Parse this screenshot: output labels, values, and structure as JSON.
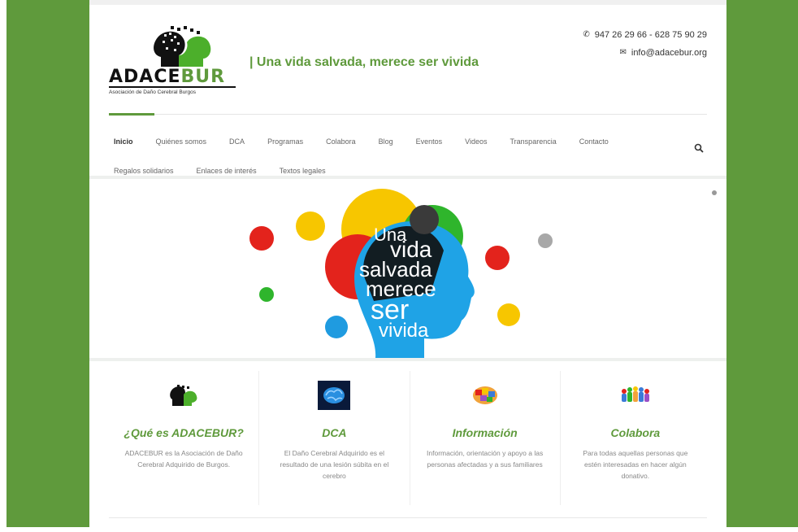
{
  "colors": {
    "accent": "#5f9a3c",
    "frame": "#5f9a3c"
  },
  "header": {
    "logo_word_main": "ADACE",
    "logo_word_accent": "BUR",
    "logo_subtitle": "Asociación de Daño Cerebral Burgos",
    "tagline": "| Una vida salvada, merece ser vivida",
    "phone": "947 26 29 66 - 628 75 90 29",
    "email": "info@adacebur.org",
    "phone_icon": "phone-icon",
    "email_icon": "envelope-icon"
  },
  "nav": {
    "row1": [
      "Inicio",
      "Quiénes somos",
      "DCA",
      "Programas",
      "Colabora",
      "Blog",
      "Eventos",
      "Videos",
      "Transparencia",
      "Contacto"
    ],
    "row2": [
      "Regalos solidarios",
      "Enlaces de interés",
      "Textos legales"
    ],
    "active": "Inicio",
    "search_icon": "search-icon"
  },
  "banner": {
    "line1": "Una",
    "line2": "vida",
    "line3": "salvada",
    "line4": "merece",
    "line5": "ser",
    "line6": "vivida"
  },
  "features": [
    {
      "title": "¿Qué es ADACEBUR?",
      "text": "ADACEBUR es la Asociación de Daño Cerebral Adquirido de Burgos.",
      "icon": "heads-logo-icon"
    },
    {
      "title": "DCA",
      "text": "El Daño Cerebral Adquirido es el resultado de una lesión súbita en el cerebro",
      "icon": "brain-icon"
    },
    {
      "title": "Información",
      "text": "Información, orientación y apoyo a las personas afectadas y a sus familiares",
      "icon": "brain-puzzle-icon"
    },
    {
      "title": "Colabora",
      "text": "Para todas aquellas personas que estén interesadas en hacer algún donativo.",
      "icon": "people-group-icon"
    }
  ]
}
